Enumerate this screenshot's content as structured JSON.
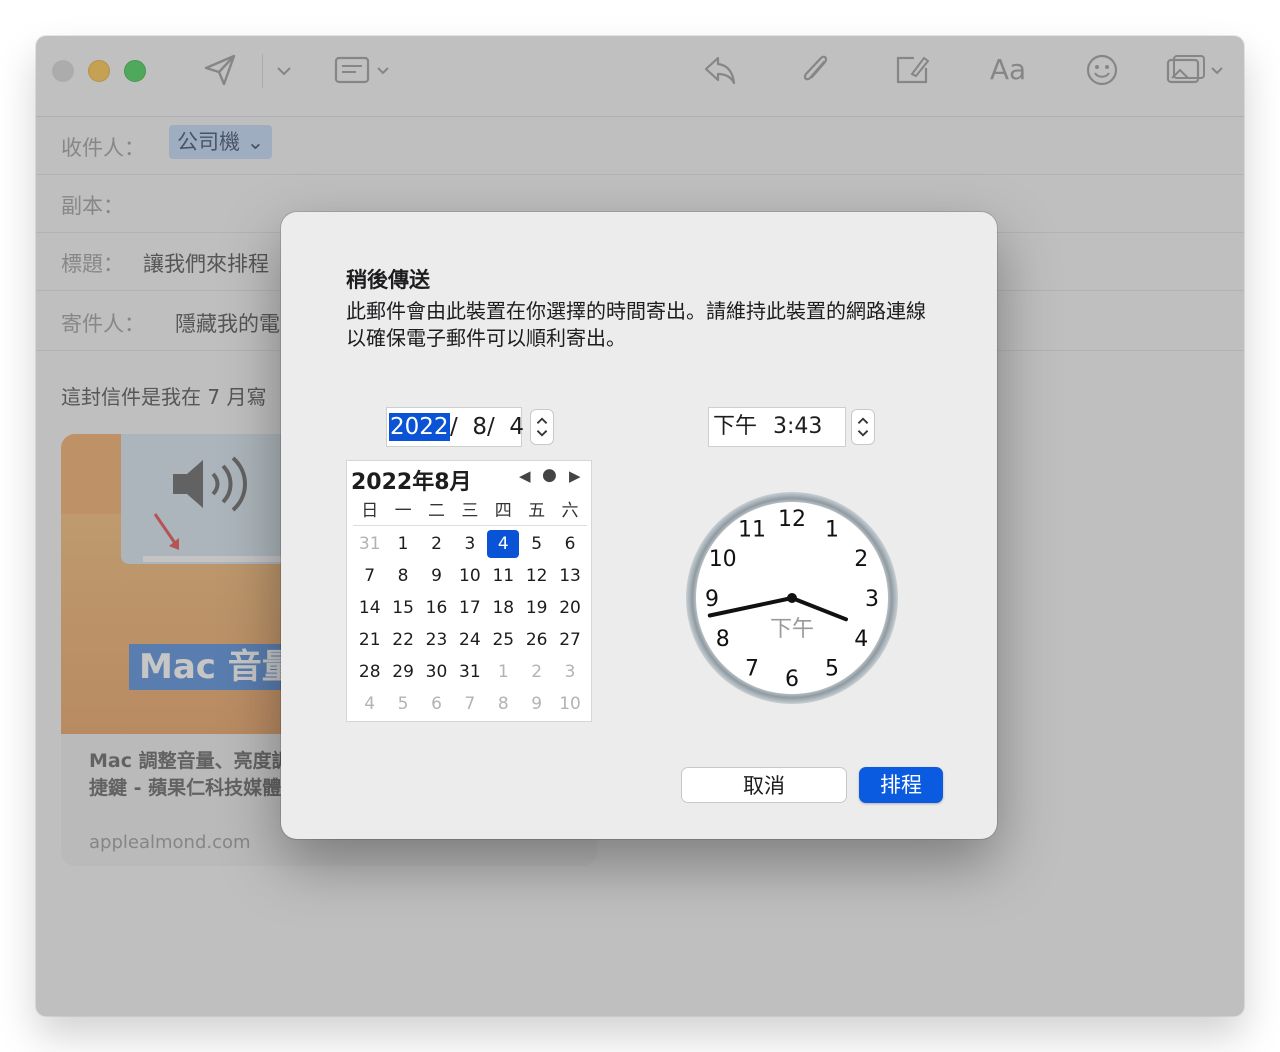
{
  "compose": {
    "to_label": "收件人：",
    "to_chip": "公司機",
    "cc_label": "副本：",
    "subject_label": "標題：",
    "subject_value": "讓我們來排程",
    "from_label": "寄件人：",
    "from_value": "隱藏我的電",
    "body_text": "這封信件是我在 7 月寫",
    "card_image_text": "Mac 音量",
    "card_title": "Mac 調整音量、亮度調」快捷鍵 - 蘋果仁科技媒體",
    "card_url": "applealmond.com"
  },
  "toolbar": {
    "icons": [
      "send-icon",
      "chevron-down-icon",
      "header-fields-icon",
      "reply-icon",
      "attachment-icon",
      "markup-icon",
      "format-text-icon",
      "emoji-icon",
      "photo-browser-icon"
    ],
    "format_label": "Aa"
  },
  "dialog": {
    "title": "稍後傳送",
    "message": "此郵件會由此裝置在你選擇的時間寄出。請維持此裝置的網路連線以確保電子郵件可以順利寄出。",
    "date_year": "2022",
    "date_rest": "/  8/  4",
    "time_period": "下午",
    "time_value": "3:43",
    "calendar": {
      "header": "2022年8月",
      "weekdays": [
        "日",
        "一",
        "二",
        "三",
        "四",
        "五",
        "六"
      ],
      "weeks": [
        [
          "31",
          "1",
          "2",
          "3",
          "4",
          "5",
          "6"
        ],
        [
          "7",
          "8",
          "9",
          "10",
          "11",
          "12",
          "13"
        ],
        [
          "14",
          "15",
          "16",
          "17",
          "18",
          "19",
          "20"
        ],
        [
          "21",
          "22",
          "23",
          "24",
          "25",
          "26",
          "27"
        ],
        [
          "28",
          "29",
          "30",
          "31",
          "1",
          "2",
          "3"
        ],
        [
          "4",
          "5",
          "6",
          "7",
          "8",
          "9",
          "10"
        ]
      ],
      "selected_day": "4"
    },
    "clock": {
      "hour": 3,
      "minute": 43,
      "period_label": "下午",
      "numbers": [
        "12",
        "1",
        "2",
        "3",
        "4",
        "5",
        "6",
        "7",
        "8",
        "9",
        "10",
        "11"
      ]
    },
    "cancel_label": "取消",
    "schedule_label": "排程"
  },
  "colors": {
    "accent": "#0a52d6",
    "dialog_bg": "#ececec"
  }
}
